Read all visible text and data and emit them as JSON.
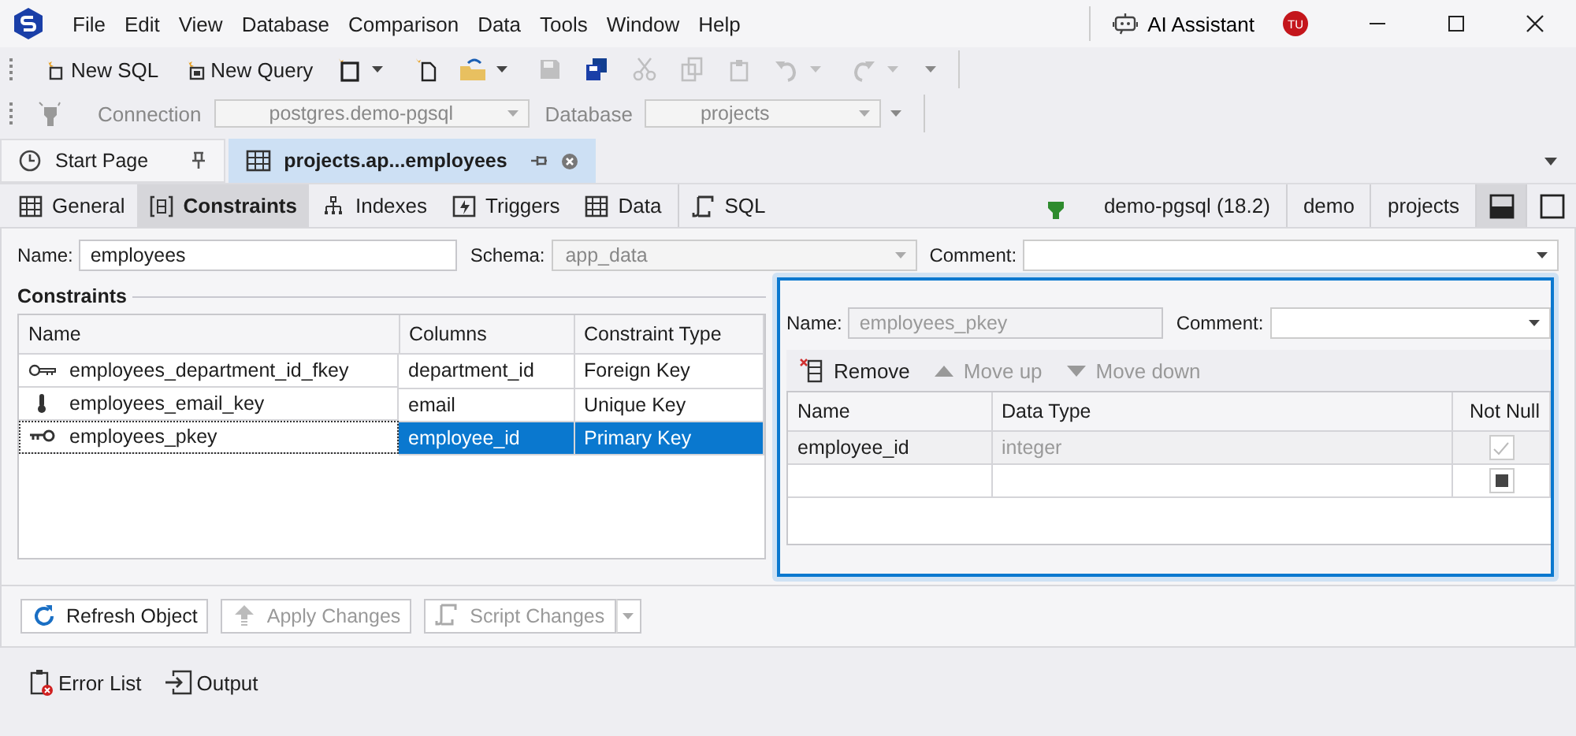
{
  "menu": {
    "items": [
      "File",
      "Edit",
      "View",
      "Database",
      "Comparison",
      "Data",
      "Tools",
      "Window",
      "Help"
    ],
    "ai_assistant": "AI Assistant",
    "avatar": "TU"
  },
  "toolbar": {
    "buttons": [
      "New SQL",
      "New Query"
    ],
    "icon_buttons": [
      {
        "disabled": false,
        "dropdown": true
      },
      {
        "disabled": false,
        "dropdown": false
      },
      {
        "disabled": false,
        "dropdown": true
      },
      {
        "disabled": true,
        "dropdown": false
      },
      {
        "disabled": false,
        "dropdown": false
      },
      {
        "disabled": true,
        "dropdown": false
      },
      {
        "disabled": true,
        "dropdown": false
      },
      {
        "disabled": true,
        "dropdown": false
      },
      {
        "disabled": true,
        "dropdown": true
      },
      {
        "disabled": true,
        "dropdown": true
      }
    ]
  },
  "connection_bar": {
    "connection_label": "Connection",
    "connection": "postgres.demo-pgsql",
    "database_label": "Database",
    "database": "projects",
    "disabled": true
  },
  "document_tabs": [
    {
      "label": "Start Page",
      "selected": false
    },
    {
      "label": "projects.ap...employees",
      "selected": true
    }
  ],
  "editor_tabs": [
    {
      "label": "General",
      "selected": false
    },
    {
      "label": "Constraints",
      "selected": true
    },
    {
      "label": "Indexes",
      "selected": false
    },
    {
      "label": "Triggers",
      "selected": false
    },
    {
      "label": "Data",
      "selected": false
    },
    {
      "label": "SQL",
      "selected": false
    }
  ],
  "connection_info": {
    "server": "demo-pgsql (18.2)",
    "user": "demo",
    "database": "projects"
  },
  "layout_buttons": [
    {
      "selected": true
    },
    {
      "selected": false
    }
  ],
  "form": {
    "name_label": "Name:",
    "name": "employees",
    "schema_label": "Schema:",
    "schema": "app_data",
    "schema_disabled": true,
    "comment_label": "Comment:"
  },
  "constraints": {
    "title": "Constraints",
    "columns": [
      "Name",
      "Columns",
      "Constraint Type"
    ],
    "rows": [
      {
        "kind": "foreign",
        "name": "employees_department_id_fkey",
        "columns": "department_id",
        "type": "Foreign Key",
        "selected": false
      },
      {
        "kind": "unique",
        "name": "employees_email_key",
        "columns": "email",
        "type": "Unique Key",
        "selected": false
      },
      {
        "kind": "primary",
        "name": "employees_pkey",
        "columns": "employee_id",
        "type": "Primary Key",
        "selected": true
      }
    ]
  },
  "detail": {
    "name_label": "Name:",
    "name": "employees_pkey",
    "name_disabled": true,
    "comment_label": "Comment:",
    "actions": [
      {
        "label": "Remove",
        "disabled": false
      },
      {
        "label": "Move up",
        "disabled": true
      },
      {
        "label": "Move down",
        "disabled": true
      }
    ],
    "columns": [
      "Name",
      "Data Type",
      "Not Null"
    ],
    "rows": [
      {
        "name": "employee_id",
        "data_type": "integer",
        "not_null": true,
        "indeterminate": false
      },
      {
        "not_null": false,
        "indeterminate": true
      }
    ]
  },
  "bottom_buttons": [
    {
      "label": "Refresh Object",
      "disabled": false,
      "dropdown": false
    },
    {
      "label": "Apply Changes",
      "disabled": true,
      "dropdown": false
    },
    {
      "label": "Script Changes",
      "disabled": true,
      "dropdown": true
    }
  ],
  "panel_tabs": [
    "Error List",
    "Output"
  ]
}
